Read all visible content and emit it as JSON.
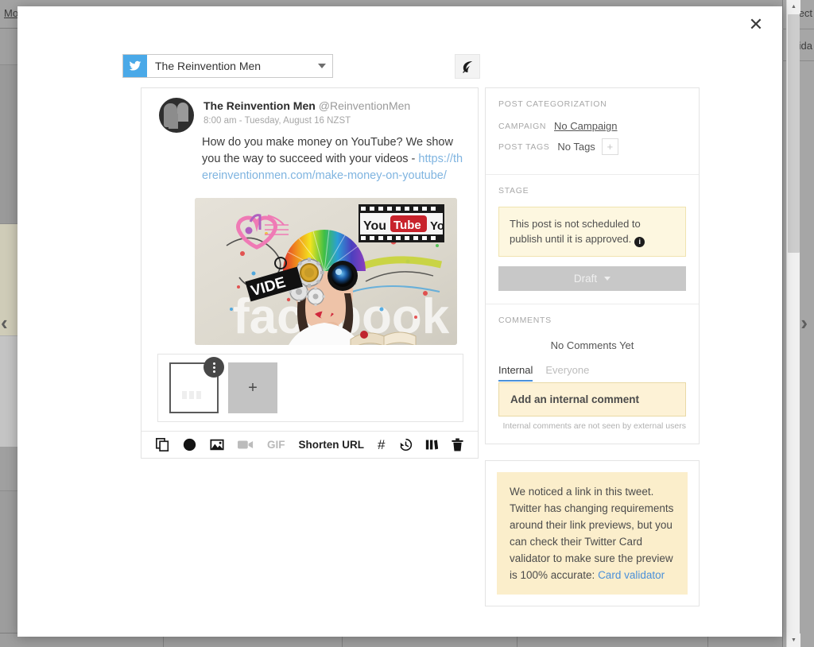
{
  "background": {
    "menu_text": "Mo",
    "right_text_1": "elect",
    "right_text_2": "Frida",
    "arrow_left": "‹",
    "arrow_right": "›"
  },
  "modal": {
    "close_label": "✕"
  },
  "profile": {
    "network": "twitter",
    "name": "The Reinvention Men",
    "leaf_icon": "leaf-icon"
  },
  "tweet": {
    "display_name": "The Reinvention Men",
    "handle": "@ReinventionMen",
    "timestamp": "8:00 am - Tuesday, August 16 NZST",
    "body_text": "How do you make money on YouTube? We show you the way to succeed with your videos - ",
    "link": "https://thereinventionmen.com/make-money-on-youtube/",
    "image_alt": "social-media-collage-image"
  },
  "attachments": {
    "add_label": "+",
    "badge_icon": "more-options-icon"
  },
  "toolbar": {
    "icons": [
      {
        "name": "duplicate-icon",
        "label": ""
      },
      {
        "name": "contrast-icon",
        "label": ""
      },
      {
        "name": "image-icon",
        "label": ""
      },
      {
        "name": "video-icon",
        "label": "",
        "disabled": true
      }
    ],
    "gif_label": "GIF",
    "shorten_url_label": "Shorten URL",
    "hashtag_label": "#",
    "right_icons": [
      {
        "name": "history-icon"
      },
      {
        "name": "library-icon"
      },
      {
        "name": "trash-icon"
      }
    ]
  },
  "sidebar": {
    "categorization": {
      "title": "POST CATEGORIZATION",
      "campaign_label": "CAMPAIGN",
      "campaign_value": "No Campaign",
      "post_tags_label": "POST TAGS",
      "post_tags_value": "No Tags",
      "add_tag_label": "+"
    },
    "stage": {
      "title": "STAGE",
      "notice": "This post is not scheduled to publish until it is approved.",
      "info_icon_label": "i",
      "button_label": "Draft"
    },
    "comments": {
      "title": "COMMENTS",
      "empty_text": "No Comments Yet",
      "tabs": [
        {
          "label": "Internal",
          "active": true
        },
        {
          "label": "Everyone",
          "active": false
        }
      ],
      "input_placeholder": "Add an internal comment",
      "hint": "Internal comments are not seen by external users"
    },
    "tip": {
      "text": "We noticed a link in this tweet. Twitter has changing requirements around their link previews, but you can check their Twitter Card validator to make sure the preview is 100% accurate: ",
      "link_label": "Card validator"
    }
  }
}
